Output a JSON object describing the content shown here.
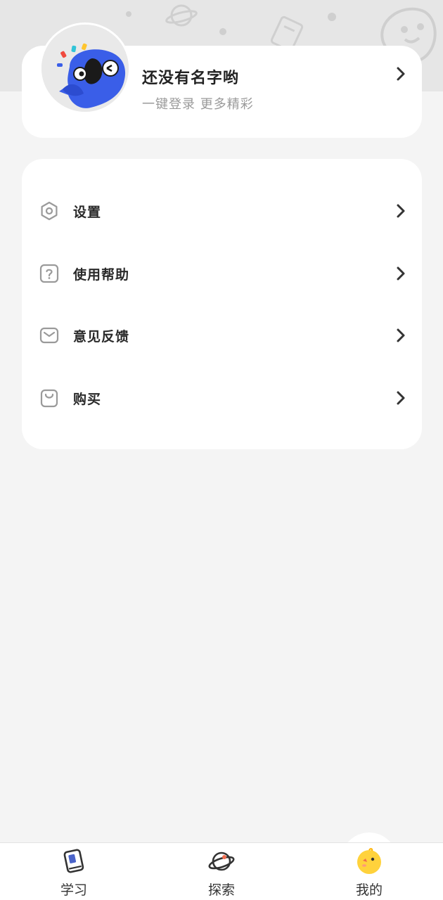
{
  "profile": {
    "name": "还没有名字哟",
    "subtitle": "一键登录 更多精彩"
  },
  "menu": {
    "items": [
      {
        "label": "设置",
        "icon": "gear-icon"
      },
      {
        "label": "使用帮助",
        "icon": "help-icon"
      },
      {
        "label": "意见反馈",
        "icon": "mail-icon"
      },
      {
        "label": "购买",
        "icon": "bag-icon"
      }
    ]
  },
  "tabbar": {
    "tabs": [
      {
        "label": "学习",
        "icon": "book-icon"
      },
      {
        "label": "探索",
        "icon": "planet-icon"
      },
      {
        "label": "我的",
        "icon": "chick-icon",
        "active": true
      }
    ]
  },
  "colors": {
    "background": "#f4f4f4",
    "header": "#e6e6e6",
    "card": "#ffffff",
    "avatar_blue": "#3a5ee8",
    "chick_yellow": "#ffd23c"
  }
}
